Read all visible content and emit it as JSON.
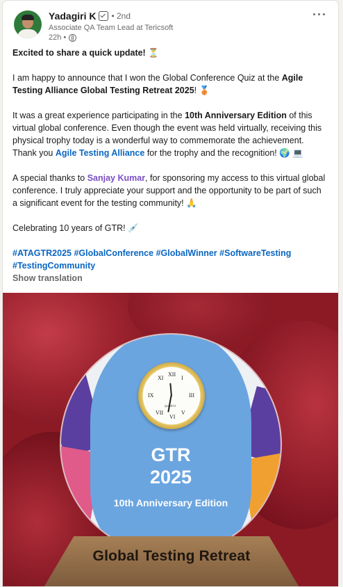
{
  "author": {
    "name": "Yadagiri K",
    "degree": "• 2nd",
    "headline": "Associate QA Team Lead at Tericsoft",
    "time": "22h •"
  },
  "post": {
    "line1_bold": "Excited to share a quick update!",
    "line1_emoji": "⏳",
    "p2_a": "I am happy to announce that I won the Global Conference Quiz at the ",
    "p2_bold": "Agile Testing Alliance Global Testing Retreat 2025",
    "p2_b": "! 🥉",
    "p3_a": "It was a great experience participating in the ",
    "p3_bold": "10th Anniversary Edition",
    "p3_b": " of this virtual global conference. Even though the event was held virtually, receiving this physical trophy today is a wonderful way to commemorate the achievement. Thank you ",
    "p3_link": "Agile Testing Alliance",
    "p3_c": " for the trophy and the recognition! 🌍 💻",
    "p4_a": "A special thanks to ",
    "p4_mention": "Sanjay Kumar",
    "p4_b": ", for sponsoring my access to this virtual global conference. I truly appreciate your support and the opportunity to be part of such a significant event for the testing community! 🙏",
    "p5": "Celebrating 10 years of GTR! 💉",
    "hashtags": [
      "#ATAGTR2025",
      "#GlobalConference",
      "#GlobalWinner",
      "#SoftwareTesting",
      "#TestingCommunity"
    ],
    "show_translation": "Show translation"
  },
  "image": {
    "gtr": "GTR",
    "year": "2025",
    "anniversary": "10th Anniversary Edition",
    "base_text": "Global Testing Retreat",
    "clock_brand": "QUARTZ"
  }
}
